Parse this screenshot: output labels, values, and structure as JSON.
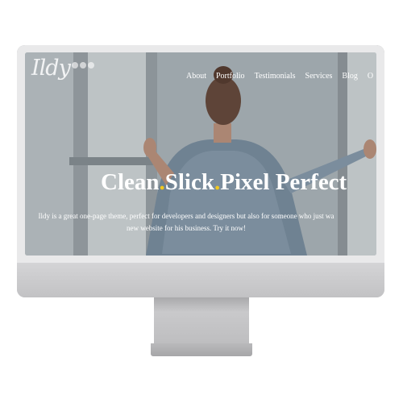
{
  "brand": {
    "logo_text": "Ildy"
  },
  "nav": {
    "items": [
      "About",
      "Portfolio",
      "Testimonials",
      "Services",
      "Blog",
      "O"
    ]
  },
  "hero": {
    "title_parts": [
      "Clean",
      ".",
      "Slick",
      ".",
      "Pixel Perfect"
    ],
    "subtitle_line1": "Ildy is a great one-page theme, perfect for developers and designers but also for someone who just wa",
    "subtitle_line2": "new website for his business. Try it now!"
  },
  "colors": {
    "accent": "#f2c81e",
    "text": "#ffffff",
    "monitor": "#c9c9cb"
  }
}
